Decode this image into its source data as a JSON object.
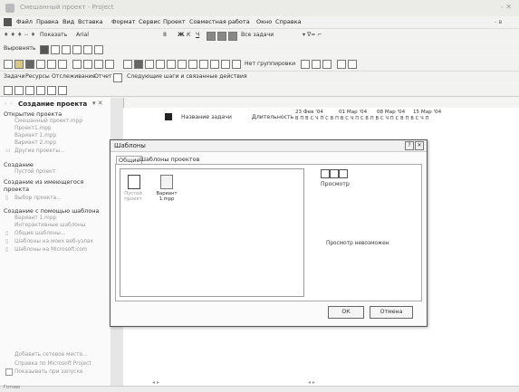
{
  "window": {
    "title": "Смешанный проект - Project",
    "controls": "- ✕",
    "help_corner": "- в"
  },
  "menu": [
    "Файл",
    "Правка",
    "Вид",
    "Вставка",
    "Формат",
    "Сервис",
    "Проект",
    "Совместная работа",
    "Окно",
    "Справка"
  ],
  "toolbar1": {
    "show": "Показать",
    "font": "Arial",
    "size": "8",
    "filter": "Все задачи"
  },
  "toolbar2": {
    "label": "Выровнять"
  },
  "toolbar3": {
    "group": "Нет группировки"
  },
  "guide_bar": {
    "items": [
      "Задачи",
      "Ресурсы",
      "Отслеживание",
      "Отчет"
    ],
    "next": "Следующие шаги и связанные действия"
  },
  "task_pane": {
    "title": "Создание проекта",
    "open_section": "Открытие проекта",
    "open_files": [
      "Смешанный проект.mpp",
      "Проект1.mpp",
      "Вариант 1.mpp",
      "Вариант 2.mpp"
    ],
    "more_projects": "Другие проекты...",
    "create_section": "Создание",
    "create_blank": "Пустой проект",
    "existing_section": "Создание из имеющегося проекта",
    "choose_project": "Выбор проекта...",
    "template_section": "Создание с помощью шаблона",
    "template_items": [
      "Вариант 1.mpp",
      "Интерактивные шаблоны",
      "Общие шаблоны...",
      "Шаблоны на моих веб-узлах",
      "Шаблоны на Microsoft.com"
    ],
    "bottom_links": [
      "Добавить сетевое место...",
      "Справка по Microsoft Project",
      "Показывать при запуске"
    ]
  },
  "gantt": {
    "col_name": "Название задачи",
    "col_duration": "Длительность",
    "weeks": [
      "23 Фев '04",
      "01 Мар '04",
      "08 Мар '04",
      "15 Мар '04"
    ],
    "days": "В П В С Ч П С В П В С Ч П С В П В С Ч П С В П В С Ч П"
  },
  "dialog": {
    "title": "Шаблоны",
    "tabs": [
      "Общие",
      "Шаблоны проектов"
    ],
    "files": [
      {
        "name": "Пустой проект"
      },
      {
        "name": "Вариант 1.mpp"
      }
    ],
    "preview_label": "Просмотр",
    "preview_unavailable": "Просмотр невозможен",
    "ok": "ОК",
    "cancel": "Отмена"
  },
  "status": {
    "text": "Готово"
  }
}
